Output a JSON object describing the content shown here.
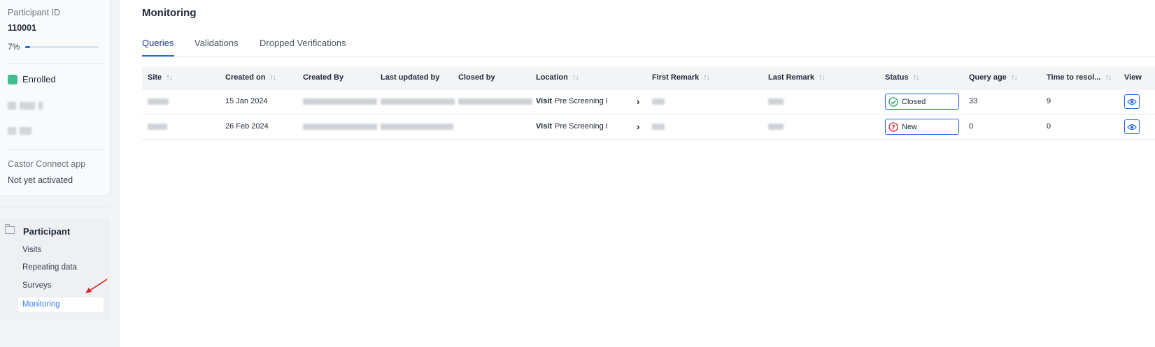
{
  "participant": {
    "id_label": "Participant ID",
    "id_value": "110001",
    "progress_text": "7%",
    "progress": 7,
    "status": "Enrolled",
    "status_color": "#3ebd93",
    "app_label": "Castor Connect app",
    "app_status": "Not yet activated"
  },
  "nav": {
    "section": "Participant",
    "items": [
      "Visits",
      "Repeating data",
      "Surveys",
      "Monitoring"
    ],
    "active": "Monitoring"
  },
  "page": {
    "title": "Monitoring",
    "tabs": [
      "Queries",
      "Validations",
      "Dropped Verifications"
    ],
    "active_tab": "Queries"
  },
  "table": {
    "columns": [
      "Site",
      "Created on",
      "Created By",
      "Last updated by",
      "Closed by",
      "Location",
      "First Remark",
      "Last Remark",
      "Status",
      "Query age",
      "Time to resol...",
      "View"
    ],
    "rows": [
      {
        "created_on": "15 Jan 2024",
        "location_prefix": "Visit",
        "location": "Pre Screening I",
        "status": "Closed",
        "query_age": "33",
        "time_to_resolve": "9"
      },
      {
        "created_on": "26 Feb 2024",
        "location_prefix": "Visit",
        "location": "Pre Screening I",
        "status": "New",
        "query_age": "0",
        "time_to_resolve": "0"
      }
    ]
  },
  "icons": {
    "status_closed": "check-circle-icon",
    "status_new": "question-circle-icon",
    "view": "eye-icon",
    "sort": "sort-arrows-icon",
    "nav": "folder-icon",
    "arrow": "red-arrow-icon"
  },
  "colors": {
    "accent": "#2563eb",
    "closed": "#22a06b",
    "new": "#dc2626",
    "annotation_arrow": "#e11d1d"
  }
}
